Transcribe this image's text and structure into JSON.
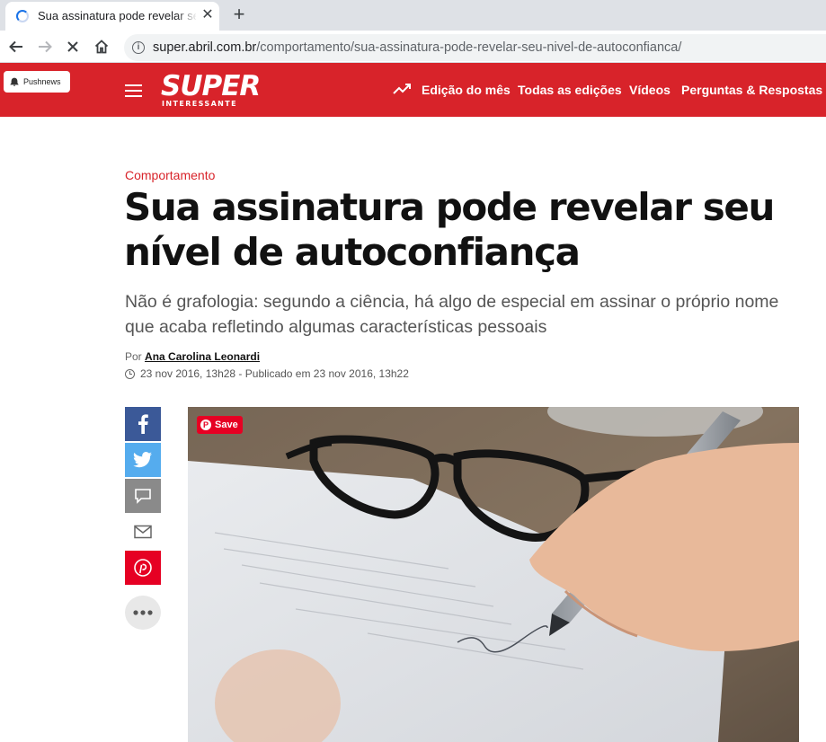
{
  "browser": {
    "tab_title": "Sua assinatura pode revelar se",
    "url_host": "super.abril.com.br",
    "url_path": "/comportamento/sua-assinatura-pode-revelar-seu-nivel-de-autoconfianca/"
  },
  "site": {
    "pushnews_label": "Pushnews",
    "logo_main": "SUPER",
    "logo_sub": "INTERESSANTE",
    "nav": [
      "Edição do mês",
      "Todas as edições",
      "Vídeos",
      "Perguntas & Respostas"
    ],
    "brand_color": "#d8232a"
  },
  "article": {
    "category": "Comportamento",
    "headline": "Sua assinatura pode revelar seu nível de autoconfiança",
    "subhead": "Não é grafologia: segundo a ciência, há algo de especial em assinar o próprio nome que acaba refletindo algumas características pessoais",
    "byline_prefix": "Por",
    "author": "Ana Carolina Leonardi",
    "dates": "23 nov 2016, 13h28 - Publicado em 23 nov 2016, 13h22",
    "pin_save": "Save"
  },
  "share": [
    {
      "icon": "facebook-icon",
      "color": "#3b5998"
    },
    {
      "icon": "twitter-icon",
      "color": "#55acee"
    },
    {
      "icon": "comment-icon",
      "color": "#8a8a8a"
    },
    {
      "icon": "email-icon",
      "color": "#ffffff"
    },
    {
      "icon": "pinterest-icon",
      "color": "#e60023"
    },
    {
      "icon": "more-icon",
      "color": "#e8e8e8"
    }
  ]
}
